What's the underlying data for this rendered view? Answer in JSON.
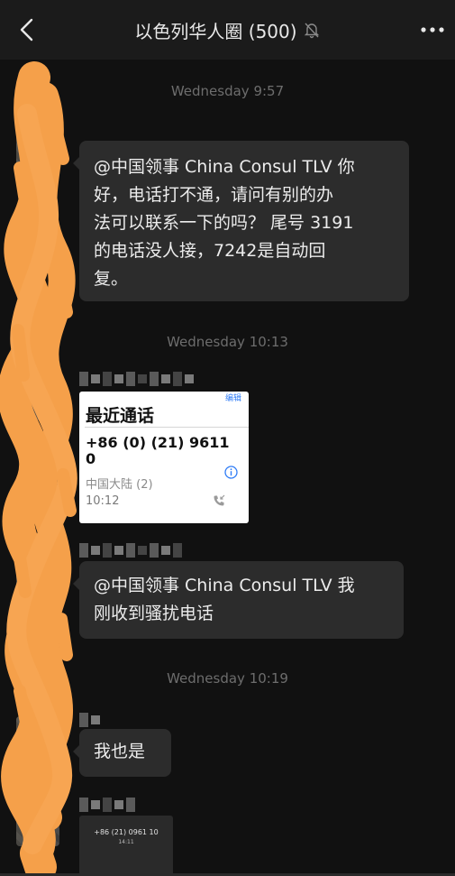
{
  "header": {
    "title": "以色列华人圈 (500)",
    "back_icon": "chevron-left-icon",
    "mute_icon": "bell-slash-icon",
    "more_icon": "ellipsis-icon"
  },
  "messages": [
    {
      "type": "time",
      "text": "Wednesday 9:57"
    },
    {
      "type": "text",
      "text": "@中国领事 China Consul TLV 你好，电话打不通，请问有别的办法可以联系一下的吗？ 尾号 3191 的电话没人接，7242是自动回复。",
      "lines": [
        "@中国领事 China Consul TLV 你",
        "好，电话打不通，请问有别的办",
        "法可以联系一下的吗？ 尾号 3191",
        "的电话没人接，7242是自动回",
        "复。"
      ]
    },
    {
      "type": "time",
      "text": "Wednesday 10:13"
    },
    {
      "type": "image",
      "edit_label": "编辑",
      "heading": "最近通话",
      "number": "+86 (0) (21) 9611 0",
      "location": "中国大陆 (2)",
      "time": "10:12"
    },
    {
      "type": "text",
      "text": "@中国领事 China Consul TLV 我刚收到骚扰电话",
      "lines": [
        "@中国领事 China Consul TLV 我",
        "刚收到骚扰电话"
      ]
    },
    {
      "type": "time",
      "text": "Wednesday 10:19"
    },
    {
      "type": "text",
      "text": "我也是",
      "lines": [
        "我也是"
      ]
    },
    {
      "type": "image-thumb",
      "number": "+86 (21) 0961 10",
      "time": "14:11"
    }
  ],
  "colors": {
    "redaction": "#f5a04a",
    "bubble": "#2c2c2c",
    "background": "#111111",
    "header": "#1b1b1b"
  }
}
